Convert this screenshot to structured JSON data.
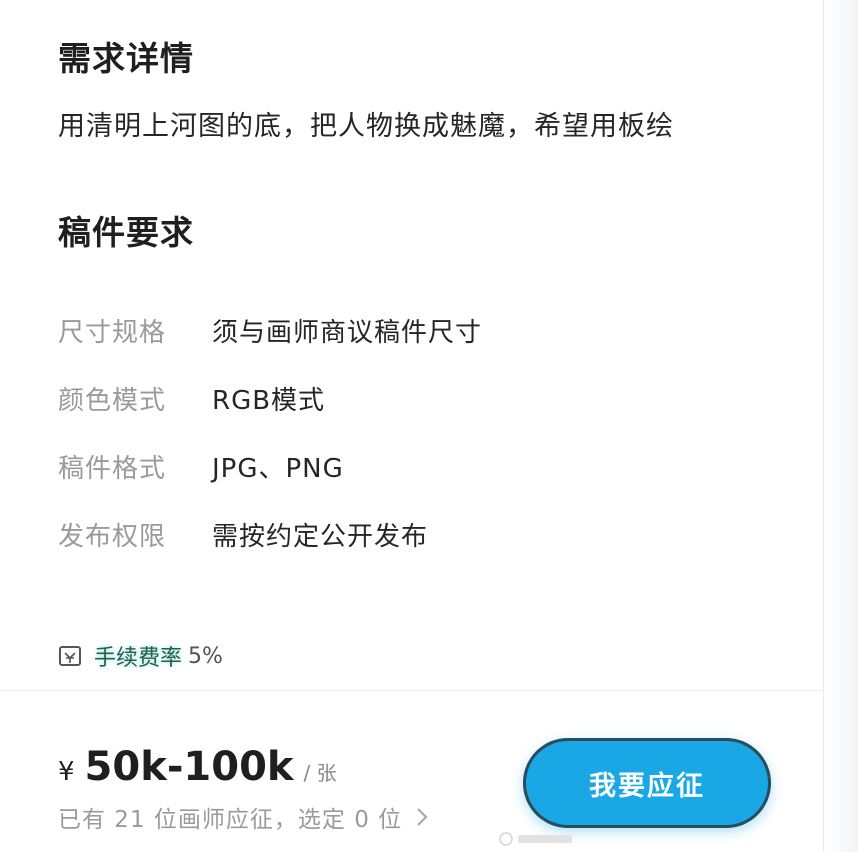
{
  "details": {
    "title": "需求详情",
    "description": "用清明上河图的底，把人物换成魅魔，希望用板绘"
  },
  "requirements": {
    "title": "稿件要求",
    "specs": [
      {
        "label": "尺寸规格",
        "value": "须与画师商议稿件尺寸"
      },
      {
        "label": "颜色模式",
        "value": "RGB模式"
      },
      {
        "label": "稿件格式",
        "value": "JPG、PNG"
      },
      {
        "label": "发布权限",
        "value": "需按约定公开发布"
      }
    ]
  },
  "fee": {
    "icon": "fee-receipt-icon",
    "label": "手续费率",
    "rate": "5%"
  },
  "footer": {
    "currency": "¥",
    "price": "50k-100k",
    "unit": "/ 张",
    "applicants_text": "已有 21 位画师应征，选定 0 位",
    "apply_button": "我要应征",
    "accent_color": "#19a7e6"
  }
}
